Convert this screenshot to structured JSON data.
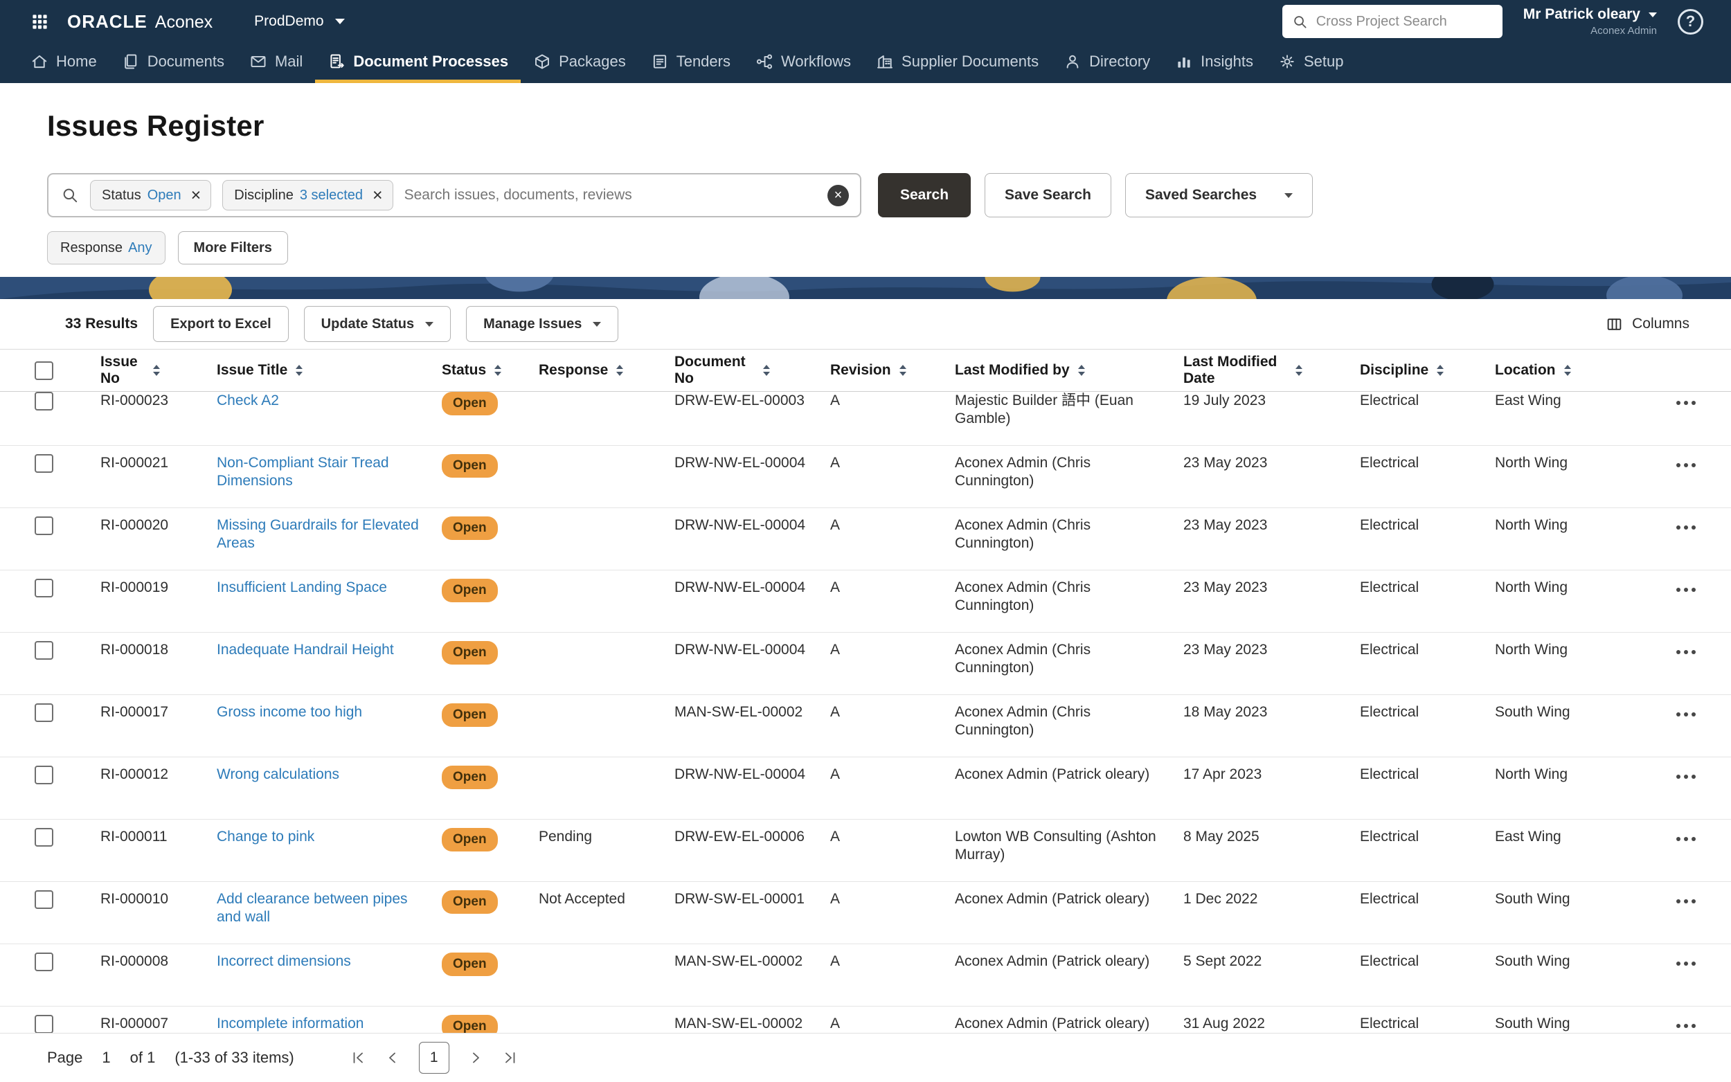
{
  "app": {
    "brand": {
      "oracle": "ORACLE",
      "product": "Aconex"
    },
    "project_selector": "ProdDemo",
    "cross_search_placeholder": "Cross Project Search",
    "user": {
      "name": "Mr Patrick oleary",
      "role": "Aconex Admin"
    }
  },
  "icons": {
    "close": "×",
    "help": "?"
  },
  "nav": {
    "items": [
      {
        "label": "Home",
        "icon": "home",
        "active": false
      },
      {
        "label": "Documents",
        "icon": "documents",
        "active": false
      },
      {
        "label": "Mail",
        "icon": "mail",
        "active": false
      },
      {
        "label": "Document Processes",
        "icon": "document-processes",
        "active": true
      },
      {
        "label": "Packages",
        "icon": "packages",
        "active": false
      },
      {
        "label": "Tenders",
        "icon": "tenders",
        "active": false
      },
      {
        "label": "Workflows",
        "icon": "workflows",
        "active": false
      },
      {
        "label": "Supplier Documents",
        "icon": "supplier-documents",
        "active": false
      },
      {
        "label": "Directory",
        "icon": "directory",
        "active": false
      },
      {
        "label": "Insights",
        "icon": "insights",
        "active": false
      },
      {
        "label": "Setup",
        "icon": "setup",
        "active": false
      }
    ]
  },
  "page": {
    "title": "Issues Register"
  },
  "filters": {
    "chips": [
      {
        "label": "Status",
        "value": "Open"
      },
      {
        "label": "Discipline",
        "value": "3 selected"
      }
    ],
    "search_placeholder": "Search issues, documents, reviews",
    "search_button": "Search",
    "save_search_button": "Save Search",
    "saved_searches_button": "Saved Searches",
    "secondary_chips": [
      {
        "label": "Response",
        "value": "Any"
      }
    ],
    "more_filters_button": "More Filters"
  },
  "toolbar": {
    "results_count": "33 Results",
    "export_button": "Export to Excel",
    "update_status_button": "Update Status",
    "manage_issues_button": "Manage Issues",
    "columns_button": "Columns"
  },
  "table": {
    "columns": [
      "Issue No",
      "Issue Title",
      "Status",
      "Response",
      "Document No",
      "Revision",
      "Last Modified by",
      "Last Modified Date",
      "Discipline",
      "Location"
    ],
    "rows": [
      {
        "issue_no": "RI-000023",
        "title": "Check A2",
        "status": "Open",
        "response": "",
        "doc_no": "DRW-EW-EL-00003",
        "revision": "A",
        "modified_by": "Majestic Builder 語中 (Euan Gamble)",
        "modified_date": "19 July 2023",
        "discipline": "Electrical",
        "location": "East Wing"
      },
      {
        "issue_no": "RI-000021",
        "title": "Non-Compliant Stair Tread Dimensions",
        "status": "Open",
        "response": "",
        "doc_no": "DRW-NW-EL-00004",
        "revision": "A",
        "modified_by": "Aconex Admin (Chris Cunnington)",
        "modified_date": "23 May 2023",
        "discipline": "Electrical",
        "location": "North Wing"
      },
      {
        "issue_no": "RI-000020",
        "title": "Missing Guardrails for Elevated Areas",
        "status": "Open",
        "response": "",
        "doc_no": "DRW-NW-EL-00004",
        "revision": "A",
        "modified_by": "Aconex Admin (Chris Cunnington)",
        "modified_date": "23 May 2023",
        "discipline": "Electrical",
        "location": "North Wing"
      },
      {
        "issue_no": "RI-000019",
        "title": "Insufficient Landing Space",
        "status": "Open",
        "response": "",
        "doc_no": "DRW-NW-EL-00004",
        "revision": "A",
        "modified_by": "Aconex Admin (Chris Cunnington)",
        "modified_date": "23 May 2023",
        "discipline": "Electrical",
        "location": "North Wing"
      },
      {
        "issue_no": "RI-000018",
        "title": "Inadequate Handrail Height",
        "status": "Open",
        "response": "",
        "doc_no": "DRW-NW-EL-00004",
        "revision": "A",
        "modified_by": "Aconex Admin (Chris Cunnington)",
        "modified_date": "23 May 2023",
        "discipline": "Electrical",
        "location": "North Wing"
      },
      {
        "issue_no": "RI-000017",
        "title": "Gross income too high",
        "status": "Open",
        "response": "",
        "doc_no": "MAN-SW-EL-00002",
        "revision": "A",
        "modified_by": "Aconex Admin (Chris Cunnington)",
        "modified_date": "18 May 2023",
        "discipline": "Electrical",
        "location": "South Wing"
      },
      {
        "issue_no": "RI-000012",
        "title": "Wrong calculations",
        "status": "Open",
        "response": "",
        "doc_no": "DRW-NW-EL-00004",
        "revision": "A",
        "modified_by": "Aconex Admin (Patrick oleary)",
        "modified_date": "17 Apr 2023",
        "discipline": "Electrical",
        "location": "North Wing"
      },
      {
        "issue_no": "RI-000011",
        "title": "Change to pink",
        "status": "Open",
        "response": "Pending",
        "doc_no": "DRW-EW-EL-00006",
        "revision": "A",
        "modified_by": "Lowton WB Consulting (Ashton Murray)",
        "modified_date": "8 May 2025",
        "discipline": "Electrical",
        "location": "East Wing"
      },
      {
        "issue_no": "RI-000010",
        "title": "Add clearance between pipes and wall",
        "status": "Open",
        "response": "Not Accepted",
        "doc_no": "DRW-SW-EL-00001",
        "revision": "A",
        "modified_by": "Aconex Admin (Patrick oleary)",
        "modified_date": "1 Dec 2022",
        "discipline": "Electrical",
        "location": "South Wing"
      },
      {
        "issue_no": "RI-000008",
        "title": "Incorrect dimensions",
        "status": "Open",
        "response": "",
        "doc_no": "MAN-SW-EL-00002",
        "revision": "A",
        "modified_by": "Aconex Admin (Patrick oleary)",
        "modified_date": "5 Sept 2022",
        "discipline": "Electrical",
        "location": "South Wing"
      },
      {
        "issue_no": "RI-000007",
        "title": "Incomplete information",
        "status": "Open",
        "response": "",
        "doc_no": "MAN-SW-EL-00002",
        "revision": "A",
        "modified_by": "Aconex Admin (Patrick oleary)",
        "modified_date": "31 Aug 2022",
        "discipline": "Electrical",
        "location": "South Wing"
      }
    ]
  },
  "pagination": {
    "page_label": "Page",
    "page_value": "1",
    "of_label": "of 1",
    "items_label": "(1-33 of 33 items)",
    "current_page": "1"
  },
  "colors": {
    "header_bg": "#1A3249",
    "active_tab_underline": "#EFB73E",
    "status_open_bg": "#EF9F42",
    "link": "#2D7BB9",
    "primary_button_bg": "#35322E"
  }
}
